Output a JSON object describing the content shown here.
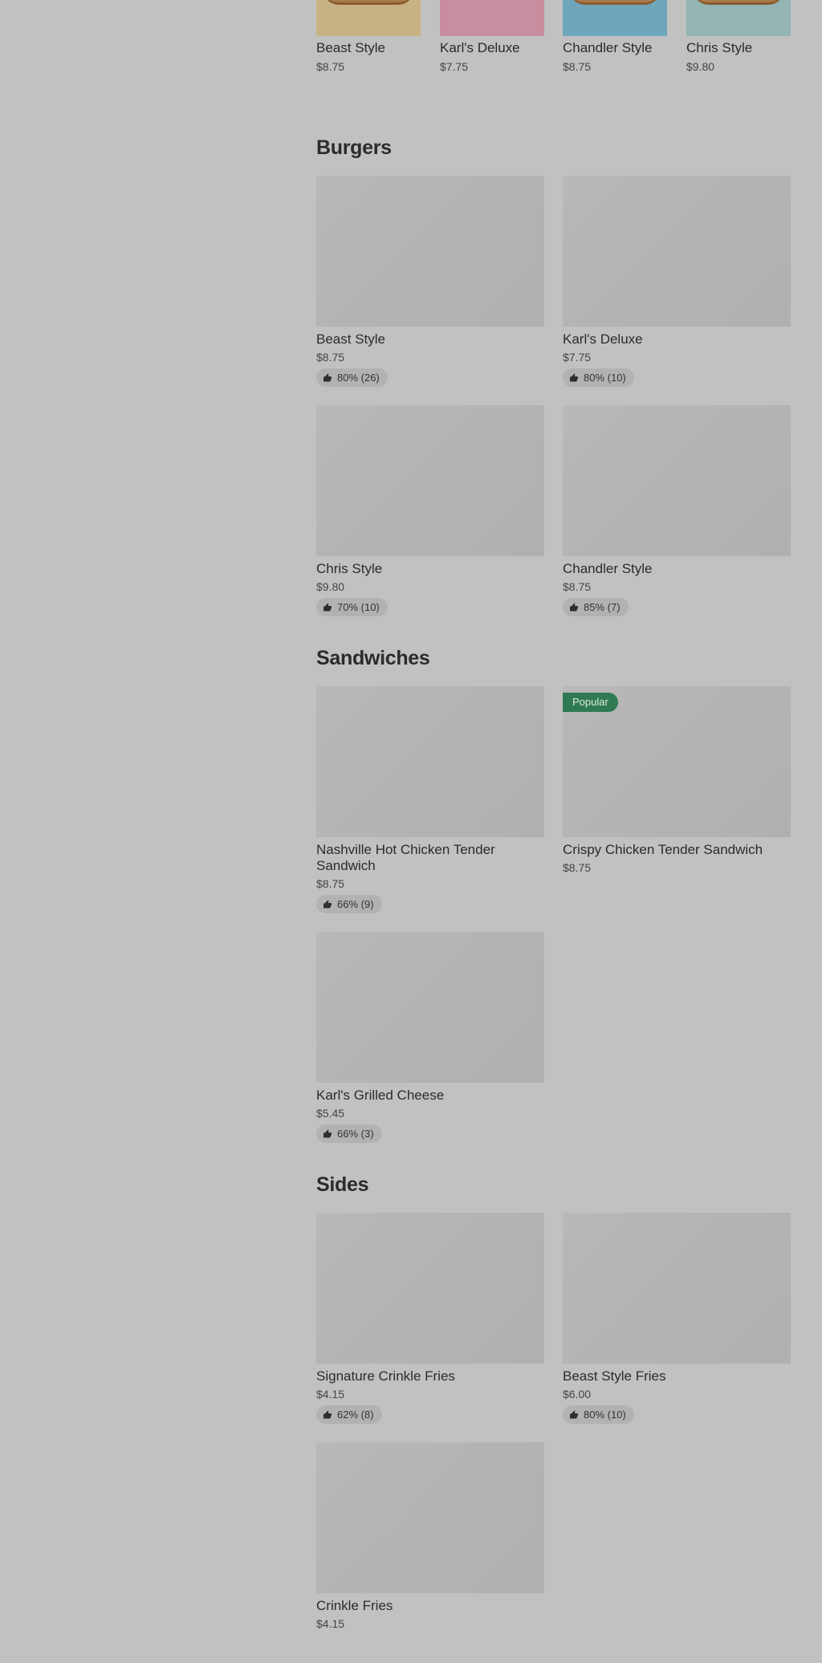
{
  "carousel": [
    {
      "name": "Beast Style",
      "price": "$8.75",
      "bg": "#c8b385"
    },
    {
      "name": "Karl's Deluxe",
      "price": "$7.75",
      "bg": "#c88d9e"
    },
    {
      "name": "Chandler Style",
      "price": "$8.75",
      "bg": "#6fa6bb"
    },
    {
      "name": "Chris Style",
      "price": "$9.80",
      "bg": "#94b5b4"
    }
  ],
  "sections": {
    "burgers": {
      "title": "Burgers",
      "items": [
        {
          "name": "Beast Style",
          "price": "$8.75",
          "rating": "80% (26)"
        },
        {
          "name": "Karl's Deluxe",
          "price": "$7.75",
          "rating": "80% (10)"
        },
        {
          "name": "Chris Style",
          "price": "$9.80",
          "rating": "70% (10)"
        },
        {
          "name": "Chandler Style",
          "price": "$8.75",
          "rating": "85% (7)"
        }
      ]
    },
    "sandwiches": {
      "title": "Sandwiches",
      "items": [
        {
          "name": "Nashville Hot Chicken Tender Sandwich",
          "price": "$8.75",
          "rating": "66% (9)"
        },
        {
          "name": "Crispy Chicken Tender Sandwich",
          "price": "$8.75",
          "badge": "Popular"
        },
        {
          "name": "Karl's Grilled Cheese",
          "price": "$5.45",
          "rating": "66% (3)"
        }
      ]
    },
    "sides": {
      "title": "Sides",
      "items": [
        {
          "name": "Signature Crinkle Fries",
          "price": "$4.15",
          "rating": "62% (8)"
        },
        {
          "name": "Beast Style Fries",
          "price": "$6.00",
          "rating": "80% (10)"
        },
        {
          "name": "Crinkle Fries",
          "price": "$4.15"
        }
      ]
    }
  },
  "colors": {
    "overlay_background": "#c1c1c1",
    "popular_badge": "#2f7a52",
    "rating_pill": "#b2b2b2"
  },
  "icons": {
    "rating": "thumbs-up-icon"
  }
}
